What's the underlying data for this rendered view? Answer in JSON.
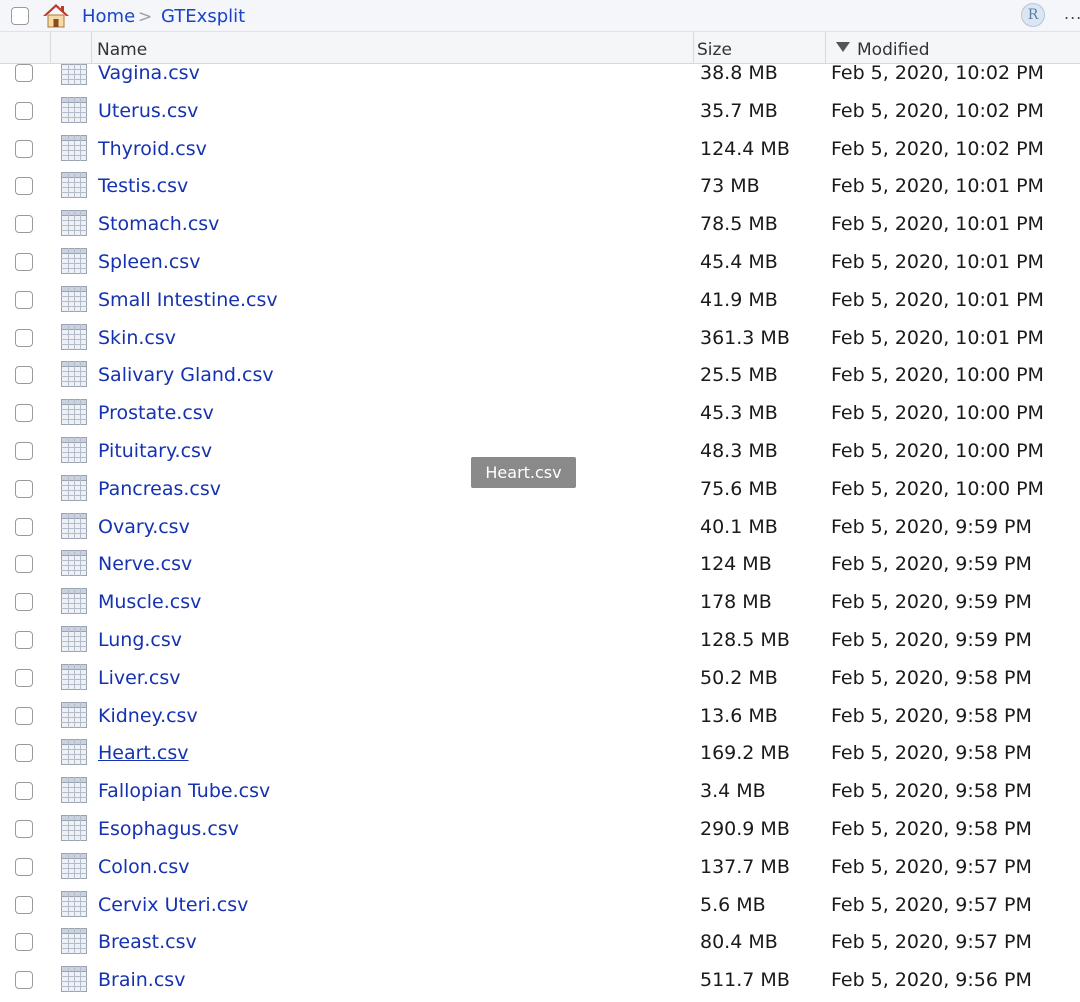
{
  "breadcrumb": {
    "items": [
      "Home",
      "GTExsplit"
    ],
    "separator": ">",
    "r_icon_label": "R",
    "more_label": "..."
  },
  "columns": {
    "name": "Name",
    "size": "Size",
    "modified": "Modified"
  },
  "sort": {
    "column": "modified",
    "direction": "descending",
    "indicator_icon": "triangle-down-icon"
  },
  "colors": {
    "link": "#1532b0",
    "breadcrumb_link": "#1a44c6",
    "home_roof": "#c0392b",
    "tooltip_bg": "#8a8a8a"
  },
  "files": [
    {
      "name": "Vagina.csv",
      "size": "38.8 MB",
      "modified": "Feb 5, 2020, 10:02 PM"
    },
    {
      "name": "Uterus.csv",
      "size": "35.7 MB",
      "modified": "Feb 5, 2020, 10:02 PM"
    },
    {
      "name": "Thyroid.csv",
      "size": "124.4 MB",
      "modified": "Feb 5, 2020, 10:02 PM"
    },
    {
      "name": "Testis.csv",
      "size": "73 MB",
      "modified": "Feb 5, 2020, 10:01 PM"
    },
    {
      "name": "Stomach.csv",
      "size": "78.5 MB",
      "modified": "Feb 5, 2020, 10:01 PM"
    },
    {
      "name": "Spleen.csv",
      "size": "45.4 MB",
      "modified": "Feb 5, 2020, 10:01 PM"
    },
    {
      "name": "Small Intestine.csv",
      "size": "41.9 MB",
      "modified": "Feb 5, 2020, 10:01 PM"
    },
    {
      "name": "Skin.csv",
      "size": "361.3 MB",
      "modified": "Feb 5, 2020, 10:01 PM"
    },
    {
      "name": "Salivary Gland.csv",
      "size": "25.5 MB",
      "modified": "Feb 5, 2020, 10:00 PM"
    },
    {
      "name": "Prostate.csv",
      "size": "45.3 MB",
      "modified": "Feb 5, 2020, 10:00 PM"
    },
    {
      "name": "Pituitary.csv",
      "size": "48.3 MB",
      "modified": "Feb 5, 2020, 10:00 PM"
    },
    {
      "name": "Pancreas.csv",
      "size": "75.6 MB",
      "modified": "Feb 5, 2020, 10:00 PM"
    },
    {
      "name": "Ovary.csv",
      "size": "40.1 MB",
      "modified": "Feb 5, 2020, 9:59 PM"
    },
    {
      "name": "Nerve.csv",
      "size": "124 MB",
      "modified": "Feb 5, 2020, 9:59 PM"
    },
    {
      "name": "Muscle.csv",
      "size": "178 MB",
      "modified": "Feb 5, 2020, 9:59 PM"
    },
    {
      "name": "Lung.csv",
      "size": "128.5 MB",
      "modified": "Feb 5, 2020, 9:59 PM"
    },
    {
      "name": "Liver.csv",
      "size": "50.2 MB",
      "modified": "Feb 5, 2020, 9:58 PM"
    },
    {
      "name": "Kidney.csv",
      "size": "13.6 MB",
      "modified": "Feb 5, 2020, 9:58 PM"
    },
    {
      "name": "Heart.csv",
      "size": "169.2 MB",
      "modified": "Feb 5, 2020, 9:58 PM",
      "hovered": true
    },
    {
      "name": "Fallopian Tube.csv",
      "size": "3.4 MB",
      "modified": "Feb 5, 2020, 9:58 PM"
    },
    {
      "name": "Esophagus.csv",
      "size": "290.9 MB",
      "modified": "Feb 5, 2020, 9:58 PM"
    },
    {
      "name": "Colon.csv",
      "size": "137.7 MB",
      "modified": "Feb 5, 2020, 9:57 PM"
    },
    {
      "name": "Cervix Uteri.csv",
      "size": "5.6 MB",
      "modified": "Feb 5, 2020, 9:57 PM"
    },
    {
      "name": "Breast.csv",
      "size": "80.4 MB",
      "modified": "Feb 5, 2020, 9:57 PM"
    },
    {
      "name": "Brain.csv",
      "size": "511.7 MB",
      "modified": "Feb 5, 2020, 9:56 PM"
    }
  ],
  "drag_tooltip": "Heart.csv"
}
